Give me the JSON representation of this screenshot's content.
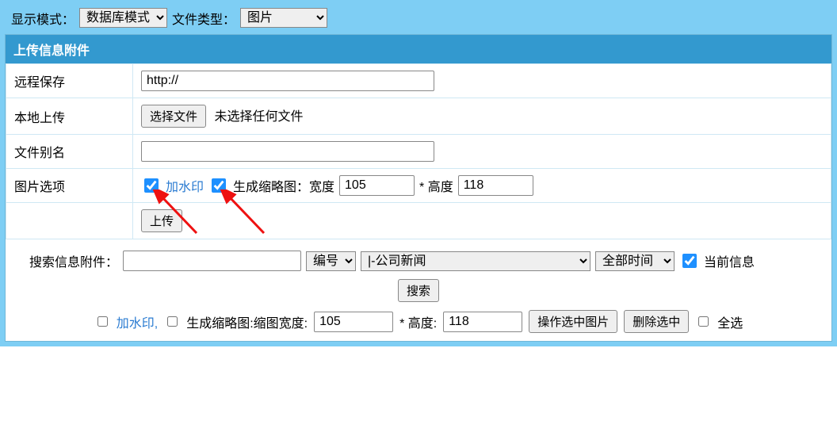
{
  "topbar": {
    "display_mode_label": "显示模式：",
    "display_mode_value": "数据库模式",
    "file_type_label": "文件类型：",
    "file_type_value": "图片"
  },
  "panel": {
    "title": "上传信息附件",
    "remote_save_label": "远程保存",
    "remote_save_value": "http://",
    "local_upload_label": "本地上传",
    "choose_file_btn": "选择文件",
    "no_file_text": "未选择任何文件",
    "file_alias_label": "文件别名",
    "file_alias_value": "",
    "image_options_label": "图片选项",
    "watermark_label": "加水印",
    "thumbnail_label": "生成缩略图：宽度",
    "width_value": "105",
    "star_height_label": "* 高度",
    "height_value": "118",
    "upload_btn": "上传"
  },
  "search": {
    "label": "搜索信息附件：",
    "input_value": "",
    "id_select": "编号",
    "category_select": "|-公司新闻",
    "time_select": "全部时间",
    "current_info_label": "当前信息",
    "search_btn": "搜索"
  },
  "ops": {
    "watermark_label": "加水印,",
    "thumb_label": "生成缩略图:缩图宽度:",
    "width_value": "105",
    "height_label": "* 高度:",
    "height_value": "118",
    "operate_btn": "操作选中图片",
    "delete_btn": "删除选中",
    "select_all_label": "全选"
  }
}
